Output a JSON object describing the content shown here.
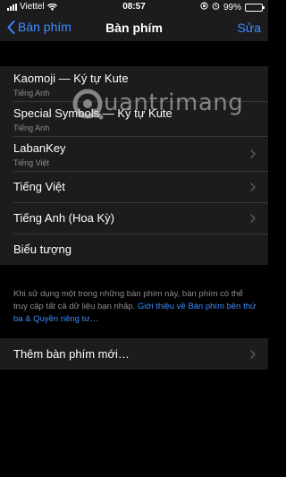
{
  "status_bar": {
    "carrier": "Viettel",
    "time": "08:57",
    "battery_percent": "99%",
    "battery_level": 0.99
  },
  "nav": {
    "back_label": "Bàn phím",
    "title": "Bàn phím",
    "edit_label": "Sửa"
  },
  "keyboards": [
    {
      "title": "Kaomoji — Ký tự Kute",
      "subtitle": "Tiếng Anh"
    },
    {
      "title": "Special Symbols — Ký tự Kute",
      "subtitle": "Tiếng Anh"
    },
    {
      "title": "LabanKey",
      "subtitle": "Tiếng Việt"
    },
    {
      "title": "Tiếng Việt",
      "subtitle": ""
    },
    {
      "title": "Tiếng Anh (Hoa Kỳ)",
      "subtitle": ""
    },
    {
      "title": "Biểu tượng",
      "subtitle": ""
    }
  ],
  "footer": {
    "note": "Khi sử dụng một trong những bàn phím này, bàn phím có thể truy cập tất cả dữ liệu bạn nhập. ",
    "link": "Giới thiệu về Bàn phím bên thứ ba & Quyền riêng tư…"
  },
  "add_keyboard": {
    "label": "Thêm bàn phím mới…"
  },
  "watermark": {
    "text": "uantrimang"
  },
  "colors": {
    "accent": "#3c8dff",
    "background": "#000000",
    "cell": "#1c1c1e",
    "secondary_text": "#8e8e93"
  }
}
